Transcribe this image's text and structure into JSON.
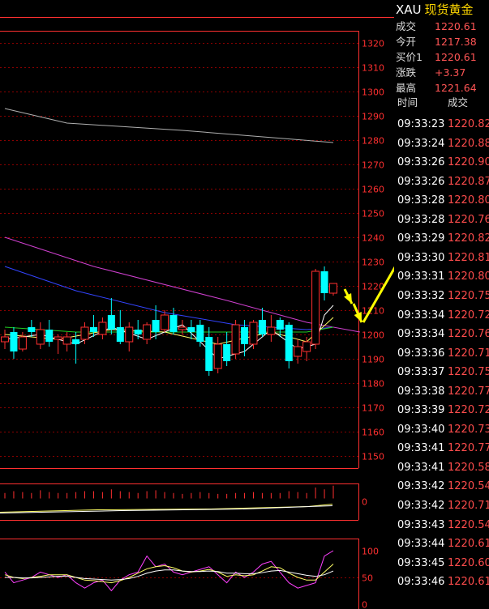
{
  "symbol": "XAU",
  "name": "现货黄金",
  "quote": [
    {
      "label": "成交",
      "value": "1220.61"
    },
    {
      "label": "今开",
      "value": "1217.38"
    },
    {
      "label": "买价1",
      "value": "1220.61"
    },
    {
      "label": "涨跌",
      "value": "+3.37"
    },
    {
      "label": "最高",
      "value": "1221.64"
    }
  ],
  "trades_header": {
    "time": "时间",
    "price": "成交"
  },
  "trades": [
    {
      "time": "09:33:23",
      "price": "1220.82"
    },
    {
      "time": "09:33:24",
      "price": "1220.88"
    },
    {
      "time": "09:33:26",
      "price": "1220.90"
    },
    {
      "time": "09:33:26",
      "price": "1220.87"
    },
    {
      "time": "09:33:28",
      "price": "1220.80"
    },
    {
      "time": "09:33:28",
      "price": "1220.76"
    },
    {
      "time": "09:33:29",
      "price": "1220.82"
    },
    {
      "time": "09:33:30",
      "price": "1220.81"
    },
    {
      "time": "09:33:31",
      "price": "1220.80"
    },
    {
      "time": "09:33:32",
      "price": "1220.75"
    },
    {
      "time": "09:33:34",
      "price": "1220.72"
    },
    {
      "time": "09:33:34",
      "price": "1220.76"
    },
    {
      "time": "09:33:36",
      "price": "1220.71"
    },
    {
      "time": "09:33:37",
      "price": "1220.75"
    },
    {
      "time": "09:33:38",
      "price": "1220.77"
    },
    {
      "time": "09:33:39",
      "price": "1220.72"
    },
    {
      "time": "09:33:40",
      "price": "1220.73"
    },
    {
      "time": "09:33:41",
      "price": "1220.77"
    },
    {
      "time": "09:33:41",
      "price": "1220.58"
    },
    {
      "time": "09:33:42",
      "price": "1220.54"
    },
    {
      "time": "09:33:42",
      "price": "1220.71"
    },
    {
      "time": "09:33:43",
      "price": "1220.54"
    },
    {
      "time": "09:33:44",
      "price": "1220.61"
    },
    {
      "time": "09:33:45",
      "price": "1220.60"
    },
    {
      "time": "09:33:46",
      "price": "1220.61"
    }
  ],
  "chart_data": [
    {
      "type": "candlestick",
      "ylim": [
        1145,
        1325
      ],
      "yticks": [
        "1320",
        "1310",
        "1300",
        "1290",
        "1280",
        "1270",
        "1260",
        "1250",
        "1240",
        "1230",
        "1220",
        "1210",
        "1200",
        "1190",
        "1180",
        "1170",
        "1160",
        "1150"
      ],
      "candles": [
        {
          "o": 1197,
          "h": 1202,
          "l": 1194,
          "c": 1199,
          "up": true
        },
        {
          "o": 1201,
          "h": 1203,
          "l": 1190,
          "c": 1193,
          "up": false
        },
        {
          "o": 1194,
          "h": 1201,
          "l": 1193,
          "c": 1199,
          "up": true
        },
        {
          "o": 1203,
          "h": 1206,
          "l": 1199,
          "c": 1201,
          "up": false
        },
        {
          "o": 1196,
          "h": 1205,
          "l": 1194,
          "c": 1202,
          "up": true
        },
        {
          "o": 1202,
          "h": 1206,
          "l": 1195,
          "c": 1197,
          "up": false
        },
        {
          "o": 1198,
          "h": 1200,
          "l": 1192,
          "c": 1199,
          "up": true
        },
        {
          "o": 1196,
          "h": 1201,
          "l": 1193,
          "c": 1199,
          "up": true
        },
        {
          "o": 1198,
          "h": 1201,
          "l": 1188,
          "c": 1196,
          "up": false
        },
        {
          "o": 1198,
          "h": 1205,
          "l": 1196,
          "c": 1203,
          "up": true
        },
        {
          "o": 1203,
          "h": 1208,
          "l": 1199,
          "c": 1201,
          "up": false
        },
        {
          "o": 1200,
          "h": 1207,
          "l": 1198,
          "c": 1205,
          "up": true
        },
        {
          "o": 1208,
          "h": 1215,
          "l": 1200,
          "c": 1202,
          "up": false
        },
        {
          "o": 1203,
          "h": 1210,
          "l": 1196,
          "c": 1197,
          "up": false
        },
        {
          "o": 1197,
          "h": 1205,
          "l": 1193,
          "c": 1203,
          "up": true
        },
        {
          "o": 1202,
          "h": 1206,
          "l": 1198,
          "c": 1200,
          "up": false
        },
        {
          "o": 1198,
          "h": 1205,
          "l": 1196,
          "c": 1204,
          "up": true
        },
        {
          "o": 1206,
          "h": 1212,
          "l": 1198,
          "c": 1201,
          "up": false
        },
        {
          "o": 1202,
          "h": 1210,
          "l": 1201,
          "c": 1208,
          "up": true
        },
        {
          "o": 1208,
          "h": 1211,
          "l": 1200,
          "c": 1201,
          "up": false
        },
        {
          "o": 1202,
          "h": 1206,
          "l": 1200,
          "c": 1203,
          "up": true
        },
        {
          "o": 1203,
          "h": 1206,
          "l": 1198,
          "c": 1201,
          "up": false
        },
        {
          "o": 1204,
          "h": 1206,
          "l": 1195,
          "c": 1197,
          "up": false
        },
        {
          "o": 1199,
          "h": 1203,
          "l": 1183,
          "c": 1185,
          "up": false
        },
        {
          "o": 1186,
          "h": 1199,
          "l": 1184,
          "c": 1196,
          "up": true
        },
        {
          "o": 1196,
          "h": 1201,
          "l": 1187,
          "c": 1189,
          "up": false
        },
        {
          "o": 1192,
          "h": 1206,
          "l": 1190,
          "c": 1204,
          "up": true
        },
        {
          "o": 1203,
          "h": 1206,
          "l": 1191,
          "c": 1196,
          "up": false
        },
        {
          "o": 1196,
          "h": 1206,
          "l": 1194,
          "c": 1205,
          "up": true
        },
        {
          "o": 1206,
          "h": 1211,
          "l": 1199,
          "c": 1200,
          "up": false
        },
        {
          "o": 1200,
          "h": 1208,
          "l": 1197,
          "c": 1203,
          "up": true
        },
        {
          "o": 1206,
          "h": 1207,
          "l": 1199,
          "c": 1202,
          "up": false
        },
        {
          "o": 1204,
          "h": 1205,
          "l": 1186,
          "c": 1189,
          "up": false
        },
        {
          "o": 1191,
          "h": 1198,
          "l": 1188,
          "c": 1195,
          "up": true
        },
        {
          "o": 1193,
          "h": 1199,
          "l": 1189,
          "c": 1197,
          "up": true
        },
        {
          "o": 1196,
          "h": 1227,
          "l": 1194,
          "c": 1226,
          "up": true
        },
        {
          "o": 1226,
          "h": 1228,
          "l": 1214,
          "c": 1217,
          "up": false
        },
        {
          "o": 1217,
          "h": 1221,
          "l": 1216,
          "c": 1221,
          "up": true
        }
      ],
      "ma_series": [
        {
          "color": "#b0b0b0",
          "points": [
            [
              0,
              1293
            ],
            [
              7,
              1287
            ],
            [
              20,
              1284
            ],
            [
              37,
              1279
            ]
          ]
        },
        {
          "color": "#d040d0",
          "points": [
            [
              0,
              1240
            ],
            [
              10,
              1228
            ],
            [
              25,
              1214
            ],
            [
              34,
              1205
            ],
            [
              40,
              1201
            ]
          ]
        },
        {
          "color": "#3344ff",
          "points": [
            [
              0,
              1228
            ],
            [
              8,
              1218
            ],
            [
              18,
              1209
            ],
            [
              26,
              1204
            ],
            [
              34,
              1202
            ],
            [
              37,
              1203
            ]
          ]
        },
        {
          "color": "#22cc22",
          "points": [
            [
              0,
              1203
            ],
            [
              8,
              1201
            ],
            [
              16,
              1201
            ],
            [
              26,
              1201
            ],
            [
              34,
              1201
            ],
            [
              37,
              1203
            ]
          ]
        },
        {
          "color": "#ffff66",
          "points": [
            [
              0,
              1200
            ],
            [
              6,
              1198
            ],
            [
              12,
              1202
            ],
            [
              18,
              1201
            ],
            [
              24,
              1196
            ],
            [
              30,
              1201
            ],
            [
              34,
              1197
            ],
            [
              37,
              1207
            ]
          ]
        },
        {
          "color": "#ffffff",
          "points": [
            [
              0,
              1198
            ],
            [
              4,
              1200
            ],
            [
              8,
              1196
            ],
            [
              12,
              1203
            ],
            [
              16,
              1198
            ],
            [
              20,
              1204
            ],
            [
              24,
              1190
            ],
            [
              27,
              1193
            ],
            [
              30,
              1202
            ],
            [
              33,
              1194
            ],
            [
              35,
              1196
            ],
            [
              36,
              1208
            ],
            [
              37,
              1212
            ]
          ]
        }
      ]
    },
    {
      "type": "bar",
      "ylim": [
        -1,
        1
      ],
      "yticks": [
        "0"
      ],
      "values": [
        0.3,
        0.4,
        0.35,
        0.3,
        0.45,
        0.35,
        0.3,
        0.3,
        0.35,
        0.4,
        0.4,
        0.35,
        0.5,
        0.4,
        0.35,
        0.3,
        0.4,
        0.45,
        0.35,
        0.3,
        0.25,
        0.3,
        0.35,
        0.3,
        0.25,
        0.25,
        0.3,
        0.3,
        0.35,
        0.3,
        0.3,
        0.3,
        0.4,
        0.35,
        0.3,
        0.6,
        0.5,
        0.7
      ]
    },
    {
      "type": "line",
      "ylim": [
        0,
        110
      ],
      "yticks": [
        "100",
        "50",
        "0"
      ],
      "series": [
        {
          "color": "#ff40ff",
          "values": [
            60,
            40,
            45,
            50,
            60,
            55,
            50,
            55,
            40,
            30,
            40,
            45,
            25,
            45,
            55,
            60,
            90,
            70,
            75,
            60,
            55,
            60,
            65,
            70,
            55,
            40,
            60,
            50,
            60,
            75,
            80,
            60,
            40,
            30,
            35,
            40,
            90,
            100
          ]
        },
        {
          "color": "#ffff66",
          "values": [
            55,
            50,
            48,
            50,
            52,
            55,
            55,
            55,
            50,
            45,
            44,
            42,
            40,
            44,
            50,
            58,
            66,
            70,
            72,
            68,
            62,
            60,
            62,
            65,
            60,
            52,
            55,
            53,
            55,
            62,
            70,
            68,
            58,
            50,
            45,
            45,
            60,
            75
          ]
        },
        {
          "color": "#ffffff",
          "values": [
            50,
            50,
            49,
            49,
            50,
            51,
            52,
            52,
            50,
            48,
            47,
            46,
            45,
            46,
            48,
            52,
            58,
            62,
            64,
            64,
            62,
            61,
            61,
            62,
            61,
            58,
            58,
            57,
            57,
            59,
            62,
            63,
            60,
            57,
            54,
            52,
            55,
            62
          ]
        }
      ]
    }
  ],
  "colors": {
    "up": "#ff3030",
    "down": "#00ffff",
    "grid": "#8b0000",
    "axis": "#ff3030",
    "arrow": "#ffff00"
  }
}
